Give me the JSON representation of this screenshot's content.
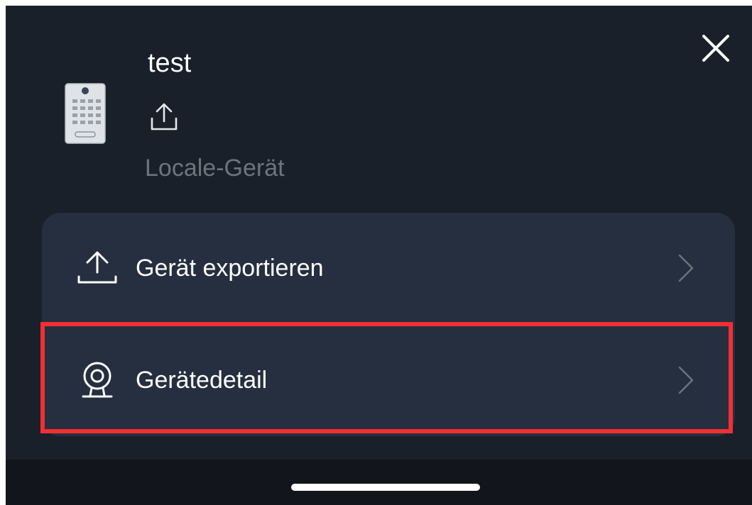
{
  "header": {
    "title": "test",
    "subtitle": "Locale-Gerät"
  },
  "menu": {
    "items": [
      {
        "label": "Gerät exportieren",
        "icon": "export-icon"
      },
      {
        "label": "Gerätedetail",
        "icon": "camera-icon"
      }
    ]
  },
  "colors": {
    "background": "#19202a",
    "card": "#262f3f",
    "highlight": "#f32f33",
    "muted_text": "#6e747c"
  }
}
